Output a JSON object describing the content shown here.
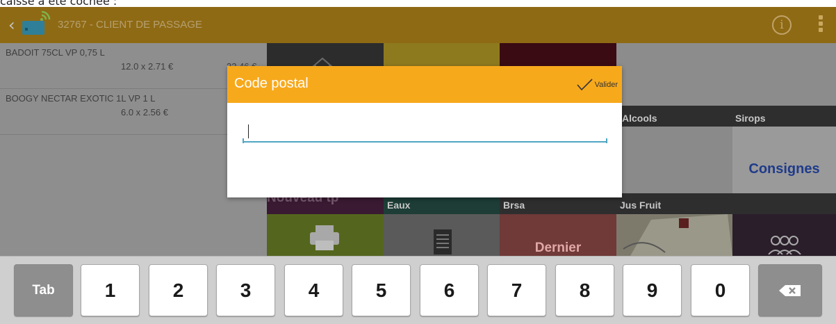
{
  "caption": "caisse a été cochée :",
  "header": {
    "client_name": "32767 - CLIENT DE PASSAGE",
    "info_icon": "info-icon",
    "menu_icon": "overflow-menu-icon"
  },
  "cart": [
    {
      "name": "BADOIT 75CL VP   0,75 L",
      "qty": "12.0 x 2.71 €",
      "price": "32,46 €"
    },
    {
      "name": "BOOGY NECTAR EXOTIC 1L VP   1 L",
      "qty": "6.0 x 2.56 €",
      "price": ""
    }
  ],
  "tiles": {
    "alcools": "Alcools",
    "sirops": "Sirops",
    "consignes": "Consignes",
    "eaux": "Eaux",
    "brsa": "Brsa",
    "jus_fruit": "Jus Fruit",
    "dernier": "Dernier",
    "nouveau": "Nouveau tp"
  },
  "dialog": {
    "title": "Code postal",
    "validate_label": "Valider",
    "field_value": ""
  },
  "keyboard": {
    "tab": "Tab",
    "digits": [
      "1",
      "2",
      "3",
      "4",
      "5",
      "6",
      "7",
      "8",
      "9",
      "0"
    ],
    "backspace_icon": "backspace-icon"
  },
  "colors": {
    "header": "#8f6a14",
    "dialog_accent": "#f7a91c",
    "field_underline": "#4fa5c3"
  }
}
